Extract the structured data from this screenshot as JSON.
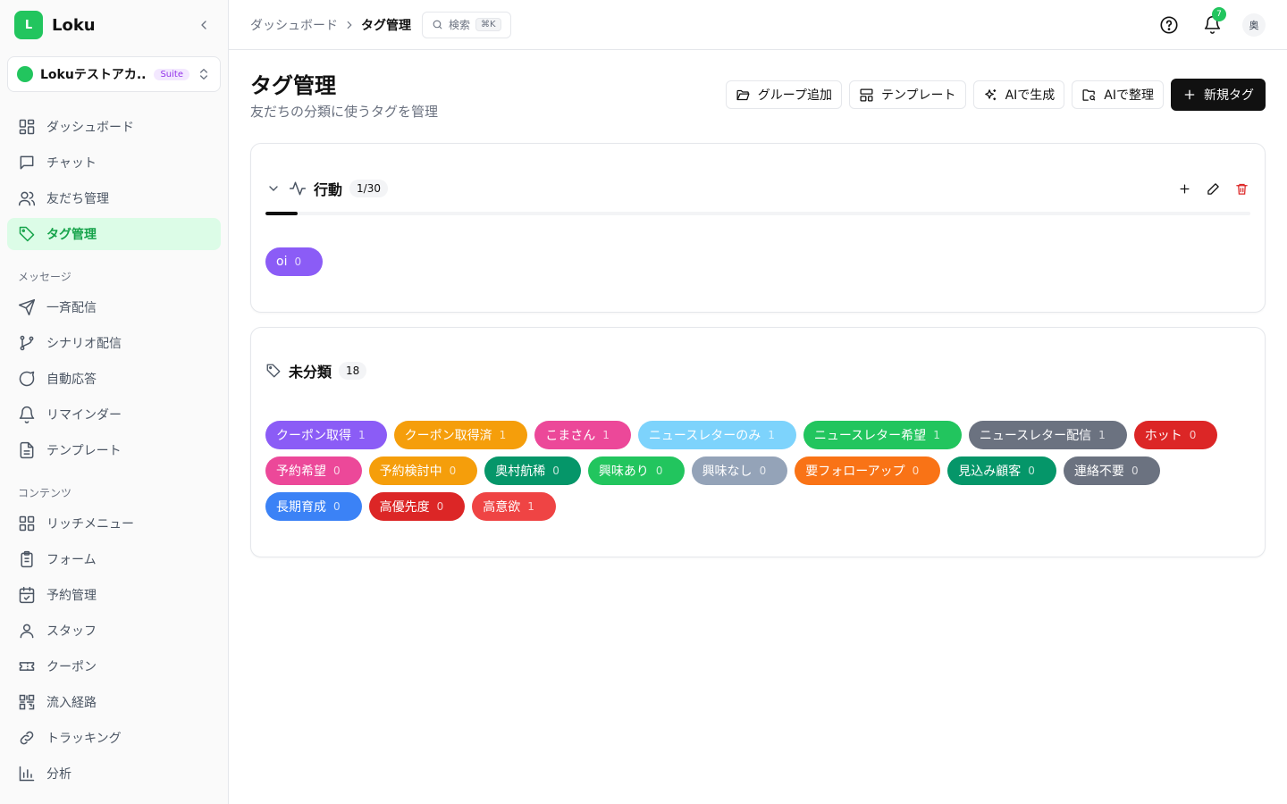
{
  "app": {
    "logo_letter": "L",
    "name": "Loku",
    "account_name": "Lokuテストアカ...",
    "account_badge": "Suite"
  },
  "sidebar": {
    "main_items": [
      {
        "label": "ダッシュボード",
        "icon": "dashboard-icon"
      },
      {
        "label": "チャット",
        "icon": "chat-icon"
      },
      {
        "label": "友だち管理",
        "icon": "users-icon"
      },
      {
        "label": "タグ管理",
        "icon": "tag-icon",
        "active": true
      }
    ],
    "message_section": "メッセージ",
    "message_items": [
      {
        "label": "一斉配信",
        "icon": "send-icon"
      },
      {
        "label": "シナリオ配信",
        "icon": "branch-icon"
      },
      {
        "label": "自動応答",
        "icon": "message-circle-icon"
      },
      {
        "label": "リマインダー",
        "icon": "bell-icon"
      },
      {
        "label": "テンプレート",
        "icon": "file-text-icon"
      }
    ],
    "content_section": "コンテンツ",
    "content_items": [
      {
        "label": "リッチメニュー",
        "icon": "grid-icon"
      },
      {
        "label": "フォーム",
        "icon": "clipboard-icon"
      },
      {
        "label": "予約管理",
        "icon": "calendar-check-icon"
      },
      {
        "label": "スタッフ",
        "icon": "user-icon"
      },
      {
        "label": "クーポン",
        "icon": "ticket-icon"
      },
      {
        "label": "流入経路",
        "icon": "qr-code-icon"
      },
      {
        "label": "トラッキング",
        "icon": "link-icon"
      },
      {
        "label": "分析",
        "icon": "bar-chart-icon"
      }
    ]
  },
  "topbar": {
    "breadcrumb_parent": "ダッシュボード",
    "breadcrumb_current": "タグ管理",
    "search_label": "検索",
    "search_shortcut": "⌘K",
    "notification_count": "7",
    "avatar_initial": "奥"
  },
  "page": {
    "title": "タグ管理",
    "subtitle": "友だちの分類に使うタグを管理",
    "actions": {
      "add_group": "グループ追加",
      "template": "テンプレート",
      "ai_generate": "AIで生成",
      "ai_organize": "AIで整理",
      "new_tag": "新規タグ"
    }
  },
  "groups": {
    "behavior": {
      "name": "行動",
      "count_label": "1/30",
      "progress_fraction": 0.033,
      "tags": [
        {
          "name": "oi",
          "count": "0",
          "color": "#8b5cf6"
        }
      ]
    },
    "uncategorized": {
      "name": "未分類",
      "count_label": "18",
      "tags": [
        {
          "name": "クーポン取得",
          "count": "1",
          "color": "#8b5cf6"
        },
        {
          "name": "クーポン取得済",
          "count": "1",
          "color": "#f59e0b"
        },
        {
          "name": "こまさん",
          "count": "1",
          "color": "#ec4899"
        },
        {
          "name": "ニュースレターのみ",
          "count": "1",
          "color": "#7dd3fc"
        },
        {
          "name": "ニュースレター希望",
          "count": "1",
          "color": "#22c55e"
        },
        {
          "name": "ニュースレター配信",
          "count": "1",
          "color": "#6b7280"
        },
        {
          "name": "ホット",
          "count": "0",
          "color": "#dc2626"
        },
        {
          "name": "予約希望",
          "count": "0",
          "color": "#ec4899"
        },
        {
          "name": "予約検討中",
          "count": "0",
          "color": "#f59e0b"
        },
        {
          "name": "奥村航稀",
          "count": "0",
          "color": "#059669"
        },
        {
          "name": "興味あり",
          "count": "0",
          "color": "#22c55e"
        },
        {
          "name": "興味なし",
          "count": "0",
          "color": "#94a3b8"
        },
        {
          "name": "要フォローアップ",
          "count": "0",
          "color": "#f97316"
        },
        {
          "name": "見込み顧客",
          "count": "0",
          "color": "#059669"
        },
        {
          "name": "連絡不要",
          "count": "0",
          "color": "#6b7280"
        },
        {
          "name": "長期育成",
          "count": "0",
          "color": "#3b82f6"
        },
        {
          "name": "高優先度",
          "count": "0",
          "color": "#dc2626"
        },
        {
          "name": "高意欲",
          "count": "1",
          "color": "#ef4444"
        }
      ]
    }
  }
}
